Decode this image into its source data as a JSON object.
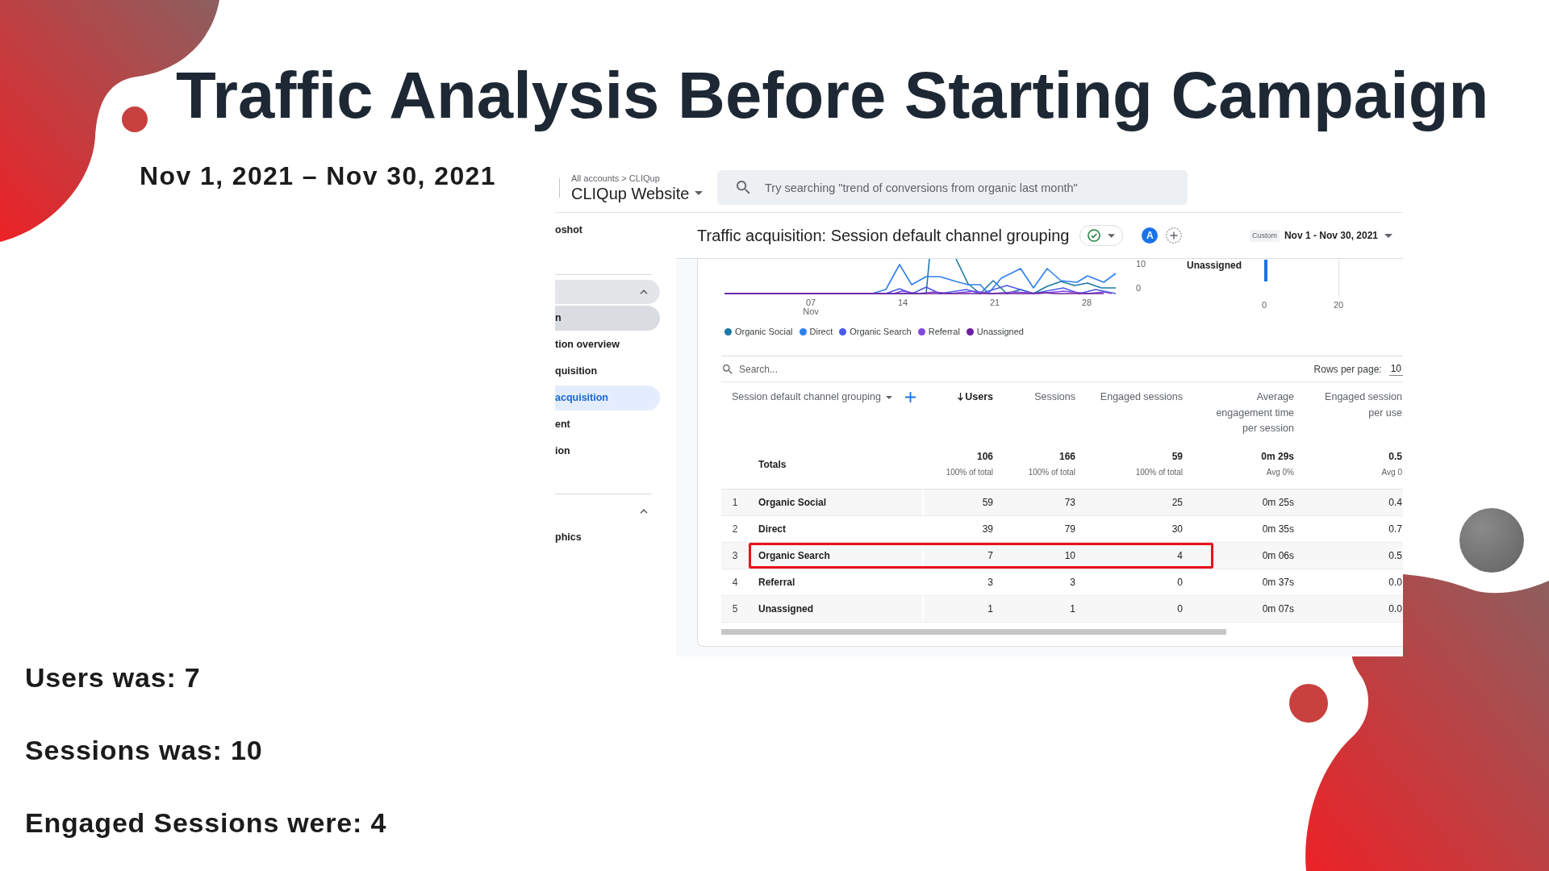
{
  "slide": {
    "title": "Traffic Analysis Before Starting Campaign",
    "date_range": "Nov 1, 2021 – Nov 30, 2021"
  },
  "analytics_screenshot": {
    "header": {
      "breadcrumb": "All accounts > CLIQup",
      "property": "CLIQup Website",
      "search": {
        "placeholder": "Try searching \"trend of conversions from organic last month\""
      }
    },
    "sidebar": {
      "top_items": [
        {
          "label": "oshot",
          "selected": false
        }
      ],
      "sections": [
        {
          "expanded": true,
          "active": true,
          "items": [
            {
              "label": "n",
              "selected": false,
              "expanded": true,
              "children": [
                {
                  "label": "tion overview",
                  "selected": false
                },
                {
                  "label": "quisition",
                  "selected": false
                },
                {
                  "label": "acquisition",
                  "selected": true
                }
              ]
            },
            {
              "label": "ent",
              "selected": false,
              "expanded": false
            },
            {
              "label": "ion",
              "selected": false,
              "expanded": false
            }
          ]
        },
        {
          "expanded": true,
          "active": false,
          "items": [
            {
              "label": "phics",
              "selected": false,
              "expanded": false
            }
          ]
        }
      ]
    },
    "report_header": {
      "title": "Traffic acquisition: Session default channel grouping",
      "avatar": "A",
      "date_tag": "Custom",
      "date_range": "Nov 1 - Nov 30, 2021"
    },
    "chart": {
      "y_labels": [
        "10",
        "0"
      ],
      "x_labels": [
        {
          "label": "07",
          "sublabel": "Nov"
        },
        {
          "label": "14"
        },
        {
          "label": "21"
        },
        {
          "label": "28"
        }
      ],
      "legend": [
        {
          "label": "Organic Social",
          "color": "#1b7aa6"
        },
        {
          "label": "Direct",
          "color": "#2f80ed"
        },
        {
          "label": "Organic Search",
          "color": "#4a5be8"
        },
        {
          "label": "Referral",
          "color": "#8348e0"
        },
        {
          "label": "Unassigned",
          "color": "#6c1f9e"
        }
      ],
      "bar_label": "Unassigned",
      "bar_axis_labels": [
        "0",
        "20"
      ]
    },
    "table": {
      "search": {
        "placeholder": "Search..."
      },
      "rows_per_page": {
        "label": "Rows per page:",
        "value": "10"
      },
      "dimension": "Session default channel grouping",
      "columns": [
        {
          "label": "Users",
          "sorted": true
        },
        {
          "label": "Sessions",
          "sorted": false
        },
        {
          "label": "Engaged sessions",
          "sorted": false
        },
        {
          "label": "Average engagement time per session",
          "sorted": false
        },
        {
          "label": "Engaged session per use",
          "sorted": false
        }
      ],
      "totals": {
        "label": "Totals",
        "values": [
          {
            "value": "106",
            "note": "100% of total"
          },
          {
            "value": "166",
            "note": "100% of total"
          },
          {
            "value": "59",
            "note": "100% of total"
          },
          {
            "value": "0m 29s",
            "note": "Avg 0%"
          },
          {
            "value": "0.5",
            "note": "Avg 0"
          }
        ]
      },
      "rows": [
        {
          "index": "1",
          "channel": "Organic Social",
          "values": [
            "59",
            "73",
            "25",
            "0m 25s",
            "0.4"
          ],
          "highlighted": false
        },
        {
          "index": "2",
          "channel": "Direct",
          "values": [
            "39",
            "79",
            "30",
            "0m 35s",
            "0.7"
          ],
          "highlighted": false
        },
        {
          "index": "3",
          "channel": "Organic Search",
          "values": [
            "7",
            "10",
            "4",
            "0m 06s",
            "0.5"
          ],
          "highlighted": true
        },
        {
          "index": "4",
          "channel": "Referral",
          "values": [
            "3",
            "3",
            "0",
            "0m 37s",
            "0.0"
          ],
          "highlighted": false
        },
        {
          "index": "5",
          "channel": "Unassigned",
          "values": [
            "1",
            "1",
            "0",
            "0m 07s",
            "0.0"
          ],
          "highlighted": false
        }
      ]
    }
  },
  "findings": [
    "Users was: 7",
    "Sessions was: 10",
    "Engaged Sessions were: 4"
  ]
}
